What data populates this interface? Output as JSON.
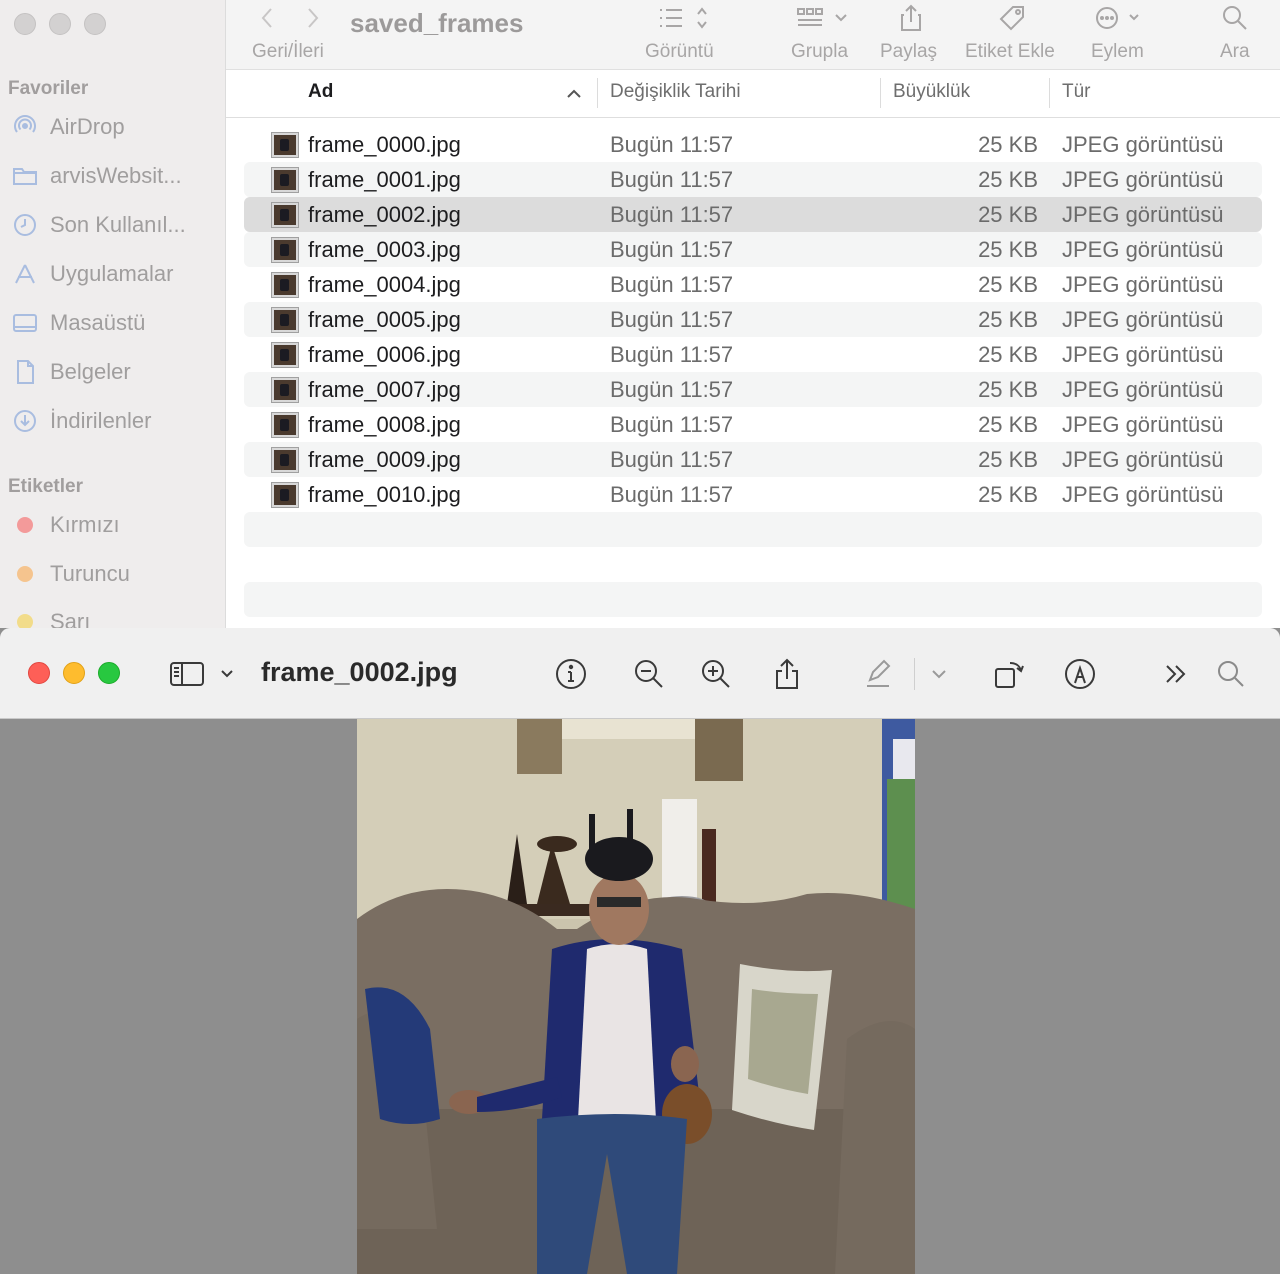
{
  "finder": {
    "sidebar": {
      "favorites_heading": "Favoriler",
      "favorites": [
        {
          "label": "AirDrop",
          "icon": "airdrop-icon"
        },
        {
          "label": "arvisWebsit...",
          "icon": "folder-icon"
        },
        {
          "label": "Son Kullanıl...",
          "icon": "clock-icon"
        },
        {
          "label": "Uygulamalar",
          "icon": "applications-icon"
        },
        {
          "label": "Masaüstü",
          "icon": "desktop-icon"
        },
        {
          "label": "Belgeler",
          "icon": "document-icon"
        },
        {
          "label": "İndirilenler",
          "icon": "download-icon"
        }
      ],
      "tags_heading": "Etiketler",
      "tags": [
        {
          "label": "Kırmızı",
          "color": "#f39a9a"
        },
        {
          "label": "Turuncu",
          "color": "#f5c48e"
        },
        {
          "label": "Sarı",
          "color": "#f2dc8a"
        }
      ]
    },
    "toolbar": {
      "title": "saved_frames",
      "nav_label": "Geri/İleri",
      "view_label": "Görüntü",
      "group_label": "Grupla",
      "share_label": "Paylaş",
      "tag_label": "Etiket Ekle",
      "action_label": "Eylem",
      "search_label": "Ara"
    },
    "columns": {
      "name": "Ad",
      "modified": "Değişiklik Tarihi",
      "size": "Büyüklük",
      "kind": "Tür"
    },
    "files": [
      {
        "name": "frame_0000.jpg",
        "date": "Bugün 11:57",
        "size": "25 KB",
        "kind": "JPEG görüntüsü"
      },
      {
        "name": "frame_0001.jpg",
        "date": "Bugün 11:57",
        "size": "25 KB",
        "kind": "JPEG görüntüsü"
      },
      {
        "name": "frame_0002.jpg",
        "date": "Bugün 11:57",
        "size": "25 KB",
        "kind": "JPEG görüntüsü"
      },
      {
        "name": "frame_0003.jpg",
        "date": "Bugün 11:57",
        "size": "25 KB",
        "kind": "JPEG görüntüsü"
      },
      {
        "name": "frame_0004.jpg",
        "date": "Bugün 11:57",
        "size": "25 KB",
        "kind": "JPEG görüntüsü"
      },
      {
        "name": "frame_0005.jpg",
        "date": "Bugün 11:57",
        "size": "25 KB",
        "kind": "JPEG görüntüsü"
      },
      {
        "name": "frame_0006.jpg",
        "date": "Bugün 11:57",
        "size": "25 KB",
        "kind": "JPEG görüntüsü"
      },
      {
        "name": "frame_0007.jpg",
        "date": "Bugün 11:57",
        "size": "25 KB",
        "kind": "JPEG görüntüsü"
      },
      {
        "name": "frame_0008.jpg",
        "date": "Bugün 11:57",
        "size": "25 KB",
        "kind": "JPEG görüntüsü"
      },
      {
        "name": "frame_0009.jpg",
        "date": "Bugün 11:57",
        "size": "25 KB",
        "kind": "JPEG görüntüsü"
      },
      {
        "name": "frame_0010.jpg",
        "date": "Bugün 11:57",
        "size": "25 KB",
        "kind": "JPEG görüntüsü"
      }
    ],
    "selected_file": "frame_0002.jpg"
  },
  "preview": {
    "title": "frame_0002.jpg",
    "icons": [
      "sidebar-toggle-icon",
      "info-icon",
      "zoom-out-icon",
      "zoom-in-icon",
      "share-icon",
      "markup-pen-icon",
      "rotate-icon",
      "annotate-icon",
      "more-icon",
      "search-icon"
    ],
    "colors": {
      "close": "#fe5f57",
      "minimize": "#febc2e",
      "zoom": "#28c840"
    }
  }
}
